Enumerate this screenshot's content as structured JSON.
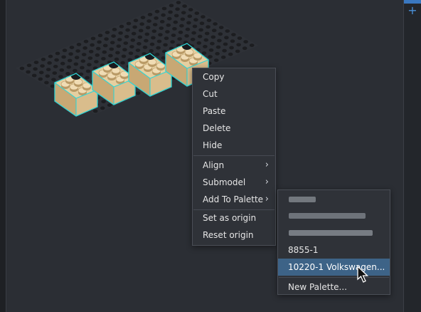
{
  "context_menu": {
    "items": [
      {
        "label": "Copy"
      },
      {
        "label": "Cut"
      },
      {
        "label": "Paste"
      },
      {
        "label": "Delete"
      },
      {
        "label": "Hide"
      },
      {
        "label": "Align",
        "submenu_arrow": "›"
      },
      {
        "label": "Submodel",
        "submenu_arrow": "›"
      },
      {
        "label": "Add To Palette",
        "submenu_arrow": "›"
      },
      {
        "label": "Set as origin"
      },
      {
        "label": "Reset origin"
      }
    ]
  },
  "palette_submenu": {
    "items": [
      {
        "label": "8855-1"
      },
      {
        "label": "10220-1 Volkswagen..."
      },
      {
        "label": "New Palette..."
      }
    ]
  },
  "toolbar": {
    "add_symbol": "+"
  },
  "colors": {
    "selection_outline": "#30d5d5",
    "brick_top": "#e6cfa0",
    "brick_side": "#c8a874",
    "stud_dark": "#1a1b1e",
    "highlight": "#3d6387",
    "accent": "#4a90d9"
  },
  "icons": [
    "add-icon",
    "chevron-right-icon",
    "mouse-pointer-icon"
  ]
}
